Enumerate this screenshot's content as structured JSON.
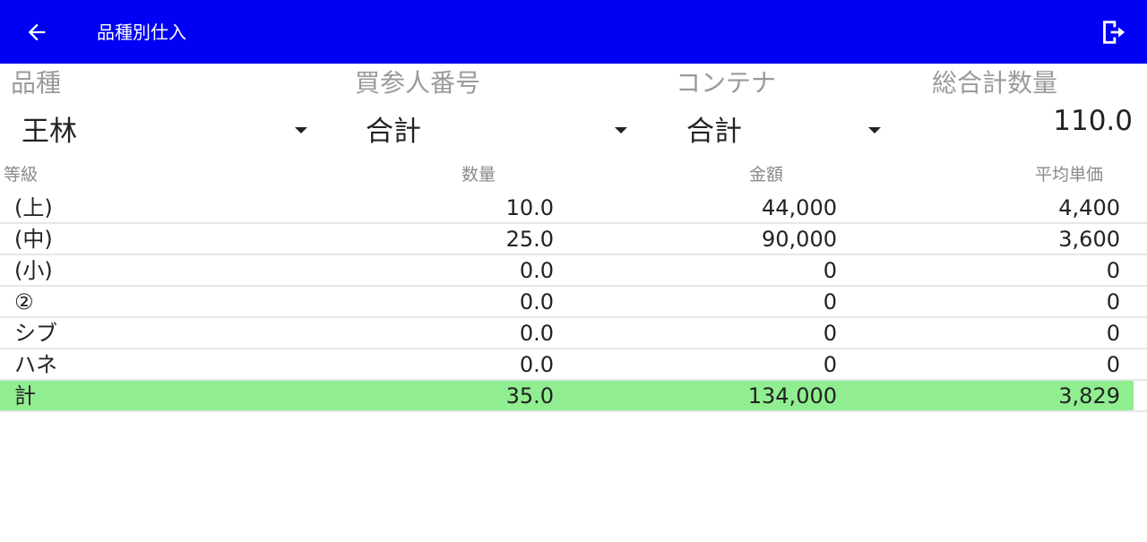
{
  "appbar": {
    "title": "品種別仕入",
    "back_icon": "arrow-left-icon",
    "exit_icon": "exit-icon",
    "color": "#0000f5"
  },
  "filters": {
    "variety": {
      "label": "品種",
      "value": "王林"
    },
    "buyer": {
      "label": "買参人番号",
      "value": "合計"
    },
    "container": {
      "label": "コンテナ",
      "value": "合計"
    },
    "grand_total": {
      "label": "総合計数量",
      "value": "110.0"
    }
  },
  "table": {
    "headers": {
      "grade": "等級",
      "qty": "数量",
      "amount": "金額",
      "avg": "平均単価"
    },
    "rows": [
      {
        "grade": "(上)",
        "qty": "10.0",
        "amount": "44,000",
        "avg": "4,400"
      },
      {
        "grade": "(中)",
        "qty": "25.0",
        "amount": "90,000",
        "avg": "3,600"
      },
      {
        "grade": "(小)",
        "qty": "0.0",
        "amount": "0",
        "avg": "0"
      },
      {
        "grade": "②",
        "qty": "0.0",
        "amount": "0",
        "avg": "0"
      },
      {
        "grade": "シブ",
        "qty": "0.0",
        "amount": "0",
        "avg": "0"
      },
      {
        "grade": "ハネ",
        "qty": "0.0",
        "amount": "0",
        "avg": "0"
      }
    ],
    "total": {
      "grade": "計",
      "qty": "35.0",
      "amount": "134,000",
      "avg": "3,829",
      "highlight": "#90ee90"
    }
  }
}
